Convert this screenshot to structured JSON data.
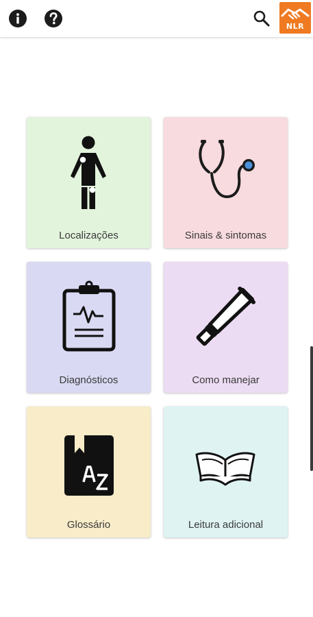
{
  "header": {
    "logo_text": "NLR",
    "icons": {
      "info": "info-icon",
      "help": "help-icon",
      "search": "search-icon",
      "logo": "nlr-logo"
    },
    "colors": {
      "logo_background": "#ef7a22"
    }
  },
  "tiles": [
    {
      "label": "Localizações",
      "icon": "person-body-icon",
      "color": "#e2f4dc"
    },
    {
      "label": "Sinais & sintomas",
      "icon": "stethoscope-icon",
      "color": "#f8dbdf"
    },
    {
      "label": "Diagnósticos",
      "icon": "clipboard-icon",
      "color": "#d9d9f3"
    },
    {
      "label": "Como manejar",
      "icon": "ointment-tube-icon",
      "color": "#ecdcf3"
    },
    {
      "label": "Glossário",
      "icon": "az-book-icon",
      "color": "#f8ecc9"
    },
    {
      "label": "Leitura adicional",
      "icon": "open-book-icon",
      "color": "#dff3f3"
    }
  ]
}
